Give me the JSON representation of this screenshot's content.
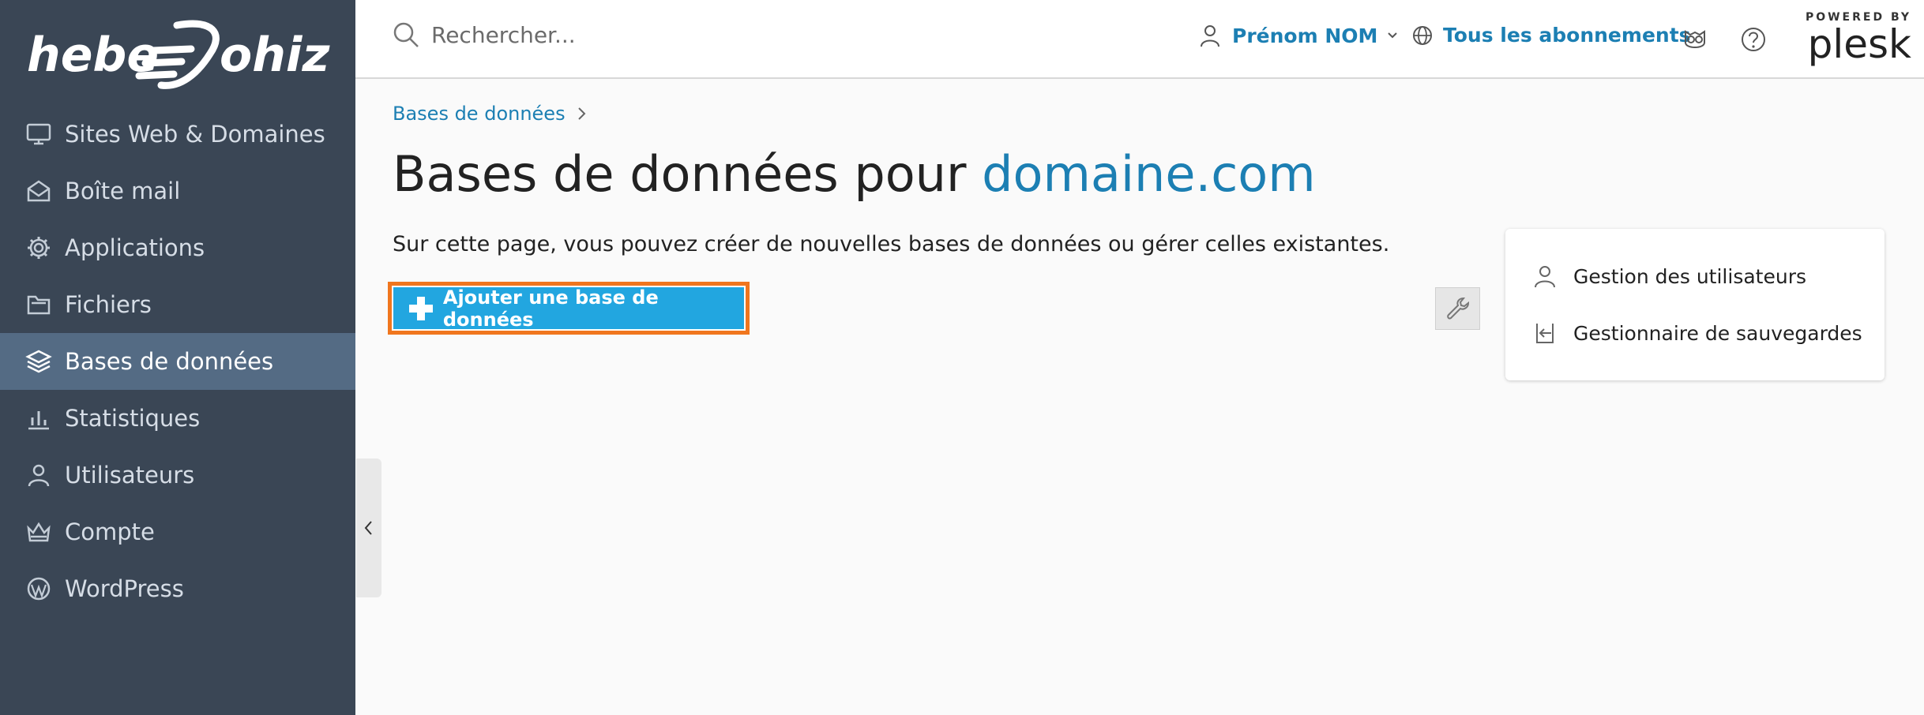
{
  "brand": {
    "logo_text": "hebergeur.johiz"
  },
  "sidebar": {
    "items": [
      {
        "label": "Sites Web & Domaines",
        "icon": "monitor-icon",
        "active": false
      },
      {
        "label": "Boîte mail",
        "icon": "envelope-icon",
        "active": false
      },
      {
        "label": "Applications",
        "icon": "gear-icon",
        "active": false
      },
      {
        "label": "Fichiers",
        "icon": "folder-icon",
        "active": false
      },
      {
        "label": "Bases de données",
        "icon": "database-layers-icon",
        "active": true
      },
      {
        "label": "Statistiques",
        "icon": "bar-chart-icon",
        "active": false
      },
      {
        "label": "Utilisateurs",
        "icon": "user-icon",
        "active": false
      },
      {
        "label": "Compte",
        "icon": "crown-icon",
        "active": false
      },
      {
        "label": "WordPress",
        "icon": "wordpress-icon",
        "active": false
      }
    ]
  },
  "header": {
    "search_placeholder": "Rechercher...",
    "user_name": "Prénom NOM",
    "subscriptions": "Tous les abonnements",
    "powered_by": "POWERED BY",
    "plesk": "plesk"
  },
  "main": {
    "breadcrumb": "Bases de données",
    "title_prefix": "Bases de données pour ",
    "title_domain": "domaine.com",
    "description": "Sur cette page, vous pouvez créer de nouvelles bases de données ou gérer celles existantes.",
    "add_button": "Ajouter une base de données"
  },
  "side_panel": {
    "items": [
      {
        "label": "Gestion des utilisateurs",
        "icon": "user-icon"
      },
      {
        "label": "Gestionnaire de sauvegardes",
        "icon": "backup-icon"
      }
    ]
  },
  "colors": {
    "sidebar_bg": "#3a4655",
    "sidebar_active": "#546b84",
    "link": "#1c7fb3",
    "button": "#22a6e0",
    "highlight": "#f0761e"
  }
}
